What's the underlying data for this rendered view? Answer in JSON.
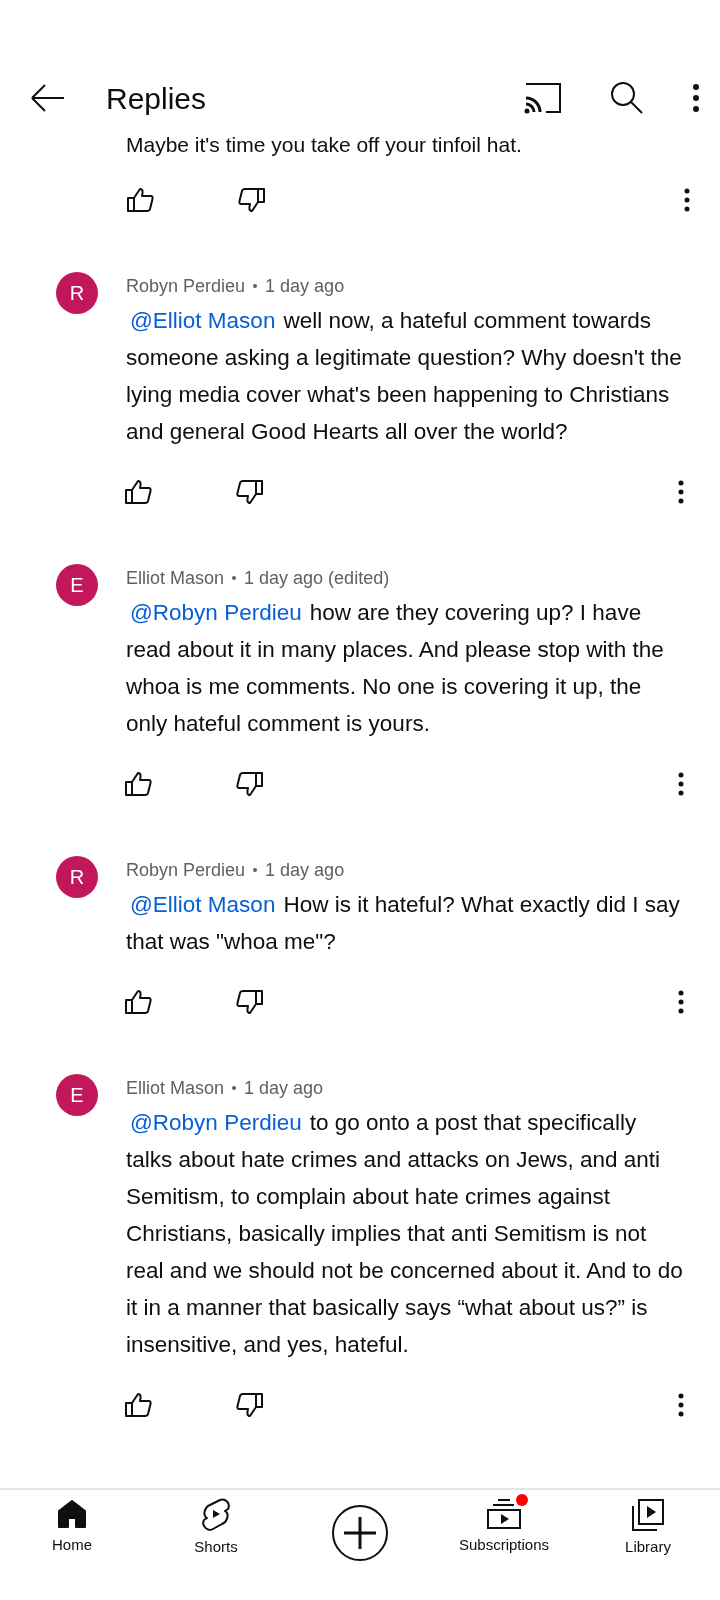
{
  "header": {
    "title": "Replies"
  },
  "partial_comment": {
    "text": "Maybe it's time you take off your tinfoil hat."
  },
  "comments": [
    {
      "avatar_letter": "R",
      "author": "Robyn Perdieu",
      "time": "1 day ago",
      "mention": "@Elliot Mason",
      "text": "well now, a hateful comment towards someone asking a legitimate question? Why doesn't the lying media cover what's been happening to Christians and general Good Hearts all over the world?"
    },
    {
      "avatar_letter": "E",
      "author": "Elliot Mason",
      "time": "1 day ago (edited)",
      "mention": "@Robyn Perdieu",
      "text": "how are they covering up? I have read about it in many places. And please stop with the whoa is me comments. No one is covering it up, the only hateful comment is yours."
    },
    {
      "avatar_letter": "R",
      "author": "Robyn Perdieu",
      "time": "1 day ago",
      "mention": "@Elliot Mason",
      "text": "How is it hateful?  What exactly did I say that was \"whoa me\"?"
    },
    {
      "avatar_letter": "E",
      "author": "Elliot Mason",
      "time": "1 day ago",
      "mention": "@Robyn Perdieu",
      "text": "to go onto a post that specifically talks about hate crimes and attacks on Jews, and anti Semitism, to complain about hate crimes against Christians, basically implies that anti Semitism is not real and we should not be concerned about it. And to do it in a manner that basically says “what about us?” is insensitive, and yes, hateful."
    }
  ],
  "nav": [
    {
      "kind": "home",
      "label": "Home",
      "selected": true
    },
    {
      "kind": "shorts",
      "label": "Shorts",
      "selected": false
    },
    {
      "kind": "create"
    },
    {
      "kind": "subscriptions",
      "label": "Subscriptions",
      "selected": false,
      "new_content": true
    },
    {
      "kind": "library",
      "label": "Library",
      "selected": false
    }
  ]
}
